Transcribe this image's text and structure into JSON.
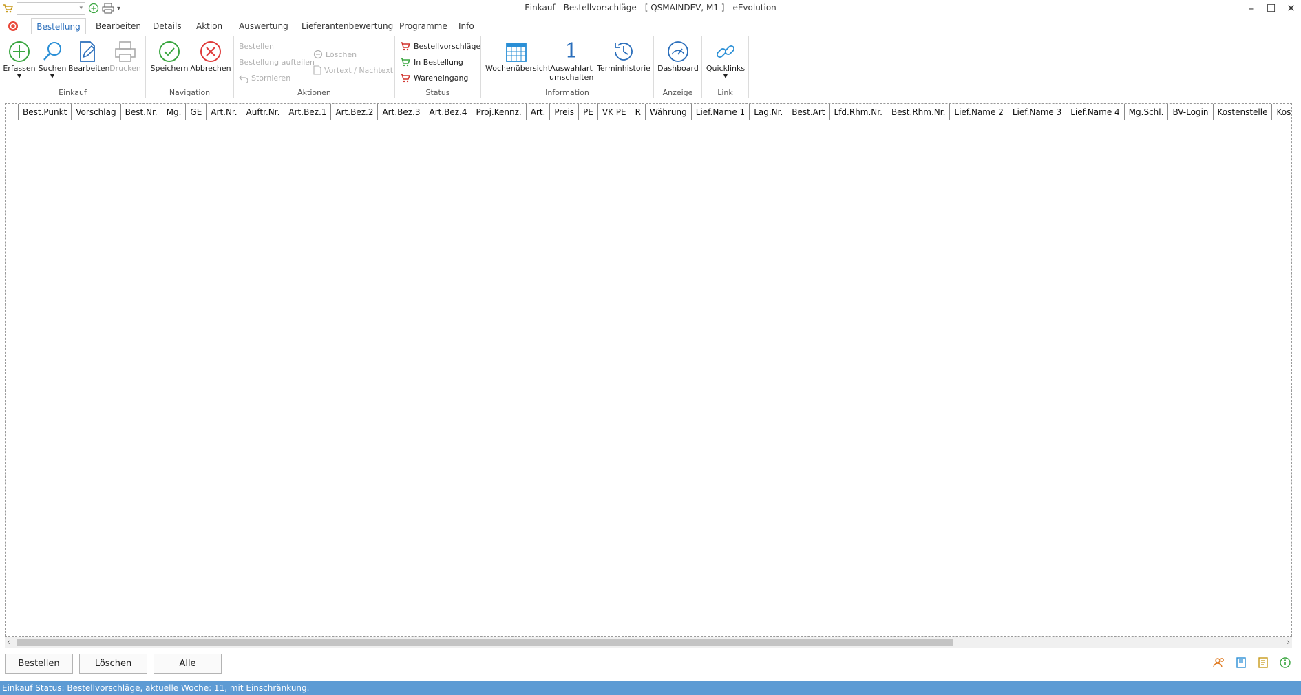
{
  "window": {
    "title": "Einkauf - Bestellvorschläge - [ QSMAINDEV, M1 ]  -  eEvolution",
    "controls": [
      "minimize-icon",
      "maximize-icon",
      "close-icon"
    ]
  },
  "quick_access": {
    "combo_value": "",
    "icons": [
      "cart-icon",
      "add-icon",
      "printer-icon",
      "dropdown-icon"
    ]
  },
  "tabs": [
    {
      "label": "Bestellung",
      "active": true
    },
    {
      "label": "Bearbeiten"
    },
    {
      "label": "Details"
    },
    {
      "label": "Aktion"
    },
    {
      "label": "Auswertung"
    },
    {
      "label": "Lieferantenbewertung"
    },
    {
      "label": "Programme"
    },
    {
      "label": "Info"
    }
  ],
  "ribbon": {
    "einkauf": {
      "label": "Einkauf",
      "erfassen": "Erfassen",
      "suchen": "Suchen",
      "bearbeiten": "Bearbeiten",
      "drucken": "Drucken"
    },
    "navigation": {
      "label": "Navigation",
      "speichern": "Speichern",
      "abbrechen": "Abbrechen"
    },
    "aktionen": {
      "label": "Aktionen",
      "bestellen": "Bestellen",
      "bestellung_aufteilen": "Bestellung aufteilen",
      "stornieren": "Stornieren",
      "loeschen": "Löschen",
      "vortext": "Vortext / Nachtext"
    },
    "status": {
      "label": "Status",
      "bestellvorschlaege": "Bestellvorschläge",
      "in_bestellung": "In Bestellung",
      "wareneingang": "Wareneingang"
    },
    "information": {
      "label": "Information",
      "wochenuebersicht": "Wochenübersicht",
      "auswahlart_line1": "Auswahlart",
      "auswahlart_line2": "umschalten",
      "auswahlart_number": "1",
      "terminhistorie": "Terminhistorie"
    },
    "anzeige": {
      "label": "Anzeige",
      "dashboard": "Dashboard"
    },
    "link": {
      "label": "Link",
      "quicklinks": "Quicklinks"
    }
  },
  "grid": {
    "columns": [
      "",
      "Best.Punkt",
      "Vorschlag",
      "Best.Nr.",
      "Mg.",
      "GE",
      "Art.Nr.",
      "Auftr.Nr.",
      "Art.Bez.1",
      "Art.Bez.2",
      "Art.Bez.3",
      "Art.Bez.4",
      "Proj.Kennz.",
      "Art.",
      "Preis",
      "PE",
      "VK PE",
      "R",
      "Währung",
      "Lief.Name 1",
      "Lag.Nr.",
      "Best.Art",
      "Lfd.Rhm.Nr.",
      "Best.Rhm.Nr.",
      "Lief.Name 2",
      "Lief.Name 3",
      "Lief.Name 4",
      "Mg.Schl.",
      "BV-Login",
      "Kostenstelle",
      "Kostenart"
    ],
    "rows": []
  },
  "footer": {
    "bestellen": "Bestellen",
    "loeschen": "Löschen",
    "alle": "Alle",
    "icons": [
      "users-icon",
      "book-icon",
      "notes-icon",
      "info-icon"
    ]
  },
  "status_text": "Einkauf Status: Bestellvorschläge, aktuelle Woche: 11, mit Einschränkung.",
  "colors": {
    "accent": "#2a6ebb",
    "statusbar": "#5d9bd4",
    "green": "#3aa640",
    "red": "#e03a3a"
  }
}
